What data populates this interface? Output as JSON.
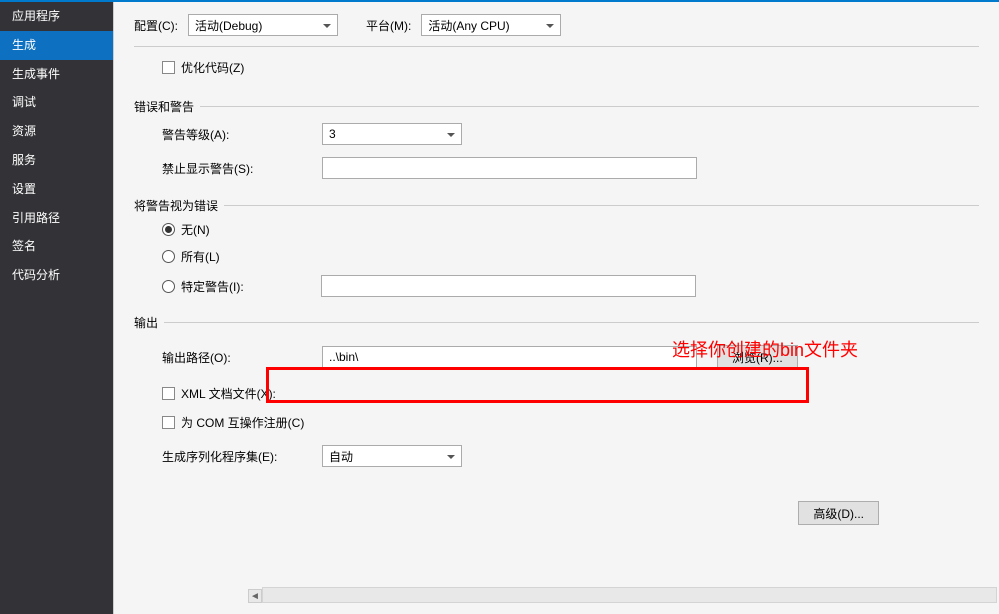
{
  "sidebar": {
    "items": [
      {
        "label": "应用程序"
      },
      {
        "label": "生成"
      },
      {
        "label": "生成事件"
      },
      {
        "label": "调试"
      },
      {
        "label": "资源"
      },
      {
        "label": "服务"
      },
      {
        "label": "设置"
      },
      {
        "label": "引用路径"
      },
      {
        "label": "签名"
      },
      {
        "label": "代码分析"
      }
    ],
    "active_index": 1
  },
  "top": {
    "config_label": "配置(C):",
    "config_value": "活动(Debug)",
    "platform_label": "平台(M):",
    "platform_value": "活动(Any CPU)"
  },
  "optimize": {
    "label": "优化代码(Z)"
  },
  "errors_section": {
    "title": "错误和警告",
    "warning_level_label": "警告等级(A):",
    "warning_level_value": "3",
    "suppress_label": "禁止显示警告(S):",
    "suppress_value": ""
  },
  "treat_warnings_section": {
    "title": "将警告视为错误",
    "none_label": "无(N)",
    "all_label": "所有(L)",
    "specific_label": "特定警告(I):",
    "specific_value": ""
  },
  "output_section": {
    "title": "输出",
    "path_label": "输出路径(O):",
    "path_value": "..\\bin\\",
    "browse_label": "浏览(R)...",
    "xml_doc_label": "XML 文档文件(X):",
    "com_interop_label": "为 COM 互操作注册(C)",
    "serialization_label": "生成序列化程序集(E):",
    "serialization_value": "自动"
  },
  "advanced_label": "高级(D)...",
  "annotation": "选择你创建的bin文件夹"
}
